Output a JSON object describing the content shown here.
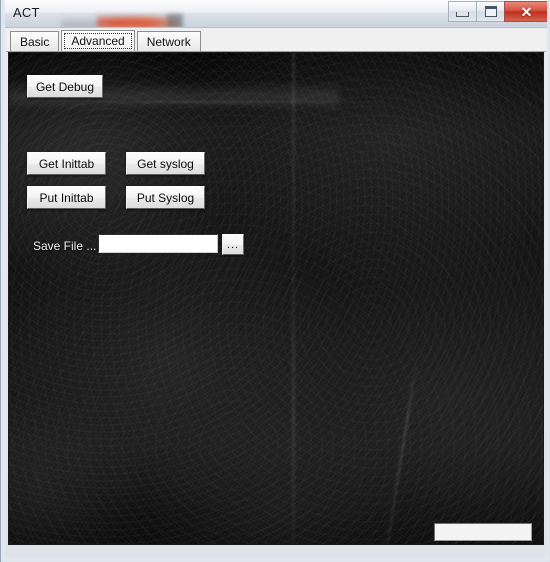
{
  "window": {
    "title": "ACT",
    "controls": {
      "minimize": {
        "name": "minimize-button",
        "glyph": "minimize-icon",
        "label": ""
      },
      "maximize": {
        "name": "maximize-button",
        "glyph": "maximize-icon",
        "label": ""
      },
      "close": {
        "name": "close-button",
        "glyph": "close-icon",
        "label": "✕"
      }
    }
  },
  "tabs": {
    "items": [
      {
        "label": "Basic",
        "selected": false
      },
      {
        "label": "Advanced",
        "selected": true
      },
      {
        "label": "Network",
        "selected": false
      }
    ]
  },
  "advanced_panel": {
    "buttons": {
      "get_debug": "Get Debug",
      "get_inittab": "Get Inittab",
      "get_syslog": "Get syslog",
      "put_inittab": "Put Inittab",
      "put_syslog": "Put Syslog",
      "browse": "..."
    },
    "save_file": {
      "label": "Save File ...",
      "value": "",
      "placeholder": ""
    },
    "status_bar": {
      "value": ""
    }
  },
  "colors": {
    "panel_background": "#121212",
    "titlebar_top": "#fdfdfe",
    "titlebar_bottom": "#ccd3dd",
    "close_button": "#c02f1f",
    "button_face": "#f4f4f4",
    "tabstrip": "#f0f0f0"
  }
}
